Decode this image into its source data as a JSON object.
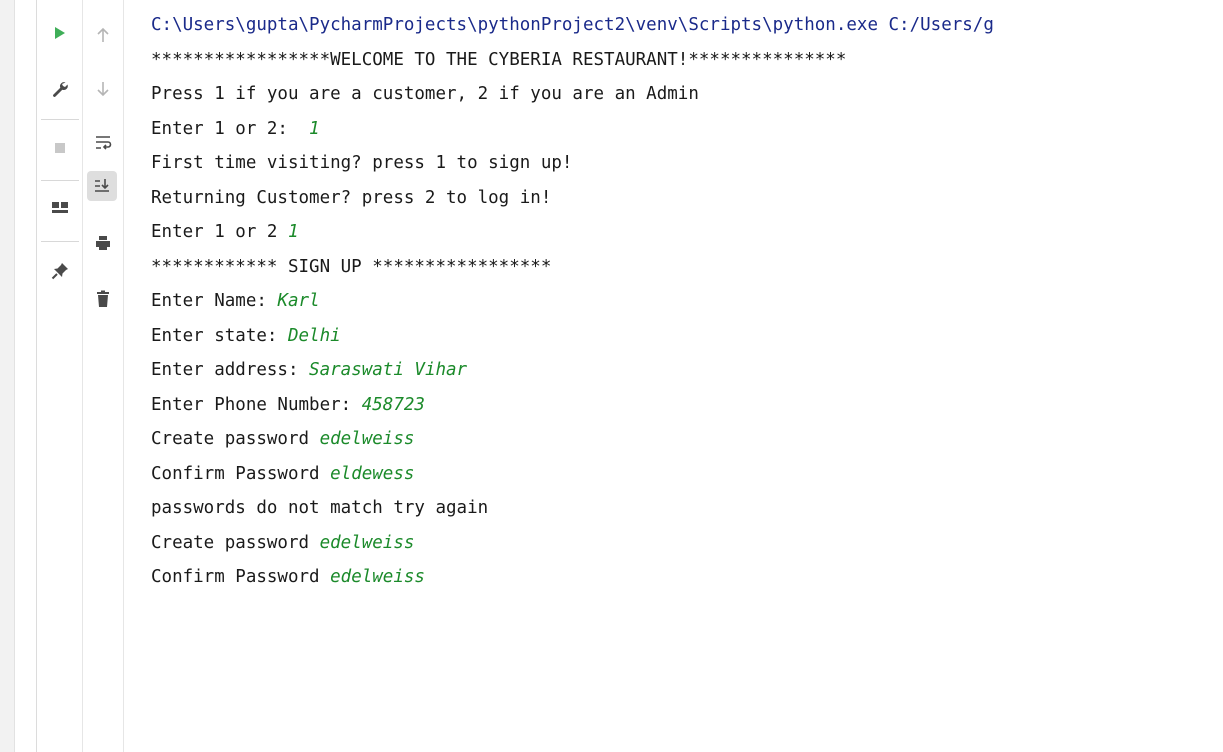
{
  "console": {
    "command": "C:\\Users\\gupta\\PycharmProjects\\pythonProject2\\venv\\Scripts\\python.exe C:/Users/g",
    "lines": [
      {
        "prompt": "*****************WELCOME TO THE CYBERIA RESTAURANT!***************",
        "input": ""
      },
      {
        "prompt": "Press 1 if you are a customer, 2 if you are an Admin",
        "input": ""
      },
      {
        "prompt": "Enter 1 or 2:  ",
        "input": "1"
      },
      {
        "prompt": "First time visiting? press 1 to sign up!",
        "input": ""
      },
      {
        "prompt": "Returning Customer? press 2 to log in!",
        "input": ""
      },
      {
        "prompt": "Enter 1 or 2 ",
        "input": "1"
      },
      {
        "prompt": "************ SIGN UP *****************",
        "input": ""
      },
      {
        "prompt": "Enter Name: ",
        "input": "Karl"
      },
      {
        "prompt": "Enter state: ",
        "input": "Delhi"
      },
      {
        "prompt": "Enter address: ",
        "input": "Saraswati Vihar"
      },
      {
        "prompt": "Enter Phone Number: ",
        "input": "458723"
      },
      {
        "prompt": "Create password ",
        "input": "edelweiss"
      },
      {
        "prompt": "Confirm Password ",
        "input": "eldewess"
      },
      {
        "prompt": "passwords do not match try again",
        "input": ""
      },
      {
        "prompt": "Create password ",
        "input": "edelweiss"
      },
      {
        "prompt": "Confirm Password ",
        "input": "edelweiss"
      }
    ]
  },
  "toolbar": {
    "left": [
      "run-icon",
      "wrench-icon",
      "stop-icon",
      "layout-icon",
      "pin-icon"
    ],
    "right": [
      "up-arrow-icon",
      "down-arrow-icon",
      "soft-wrap-icon",
      "scroll-to-end-icon",
      "print-icon",
      "trash-icon"
    ]
  },
  "colors": {
    "command": "#1a2a8a",
    "user_input": "#1b8a2a",
    "run_icon": "#3fae58"
  }
}
